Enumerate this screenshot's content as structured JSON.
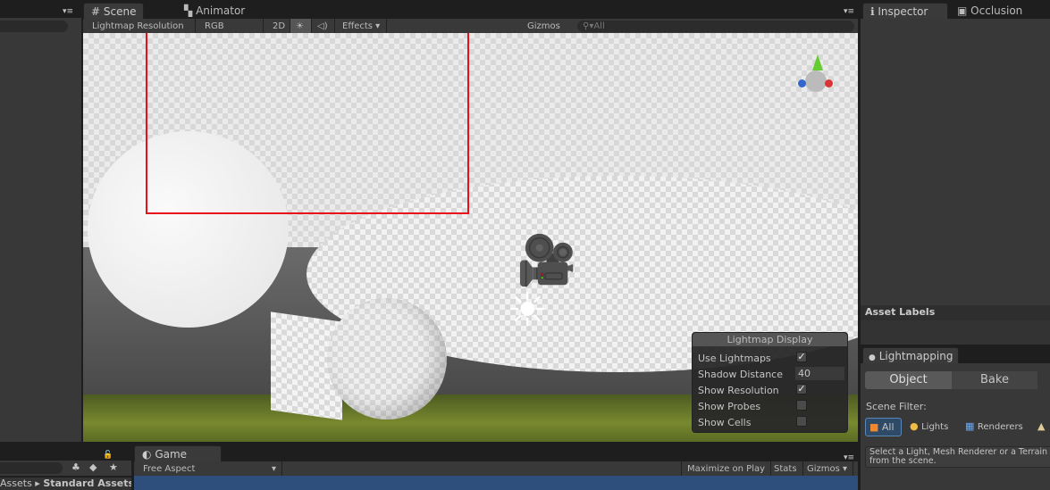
{
  "scene": {
    "tab": "Scene",
    "tab2": "Animator",
    "draw_mode": "Lightmap Resolution",
    "render_mode": "RGB",
    "btn_2d": "2D",
    "effects": "Effects",
    "gizmos": "Gizmos",
    "search_placeholder": "All"
  },
  "lightmap_display": {
    "title": "Lightmap Display",
    "rows": [
      {
        "label": "Use Lightmaps",
        "checked": true
      },
      {
        "label": "Shadow Distance",
        "value": "40"
      },
      {
        "label": "Show Resolution",
        "checked": true
      },
      {
        "label": "Show Probes",
        "checked": false
      },
      {
        "label": "Show Cells",
        "checked": false
      }
    ]
  },
  "inspector": {
    "tab": "Inspector",
    "tab2": "Occlusion",
    "asset_labels": "Asset Labels"
  },
  "lightmapping": {
    "tab": "Lightmapping",
    "object": "Object",
    "bake": "Bake",
    "scene_filter": "Scene Filter:",
    "filters": [
      "All",
      "Lights",
      "Renderers"
    ],
    "hint": "Select a Light, Mesh Renderer or a Terrain from the scene."
  },
  "game": {
    "tab": "Game",
    "aspect": "Free Aspect",
    "maximize": "Maximize on Play",
    "stats": "Stats",
    "gizmos": "Gizmos"
  },
  "project": {
    "breadcrumb_root": "Assets",
    "breadcrumb_current": "Standard Assets"
  },
  "colors": {
    "selection_rect": "#e8101a",
    "game_view": "#2e4f7c"
  }
}
